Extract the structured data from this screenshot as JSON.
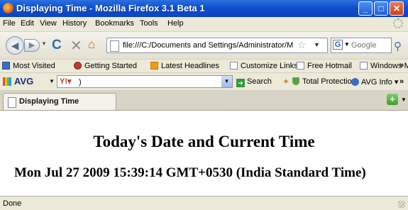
{
  "window": {
    "title": "Displaying Time - Mozilla Firefox 3.1 Beta 1",
    "buttons": {
      "minimize": "_",
      "maximize": "□",
      "close": "✕"
    }
  },
  "menu": {
    "items": [
      "File",
      "Edit",
      "View",
      "History",
      "Bookmarks",
      "Tools",
      "Help"
    ]
  },
  "navigation": {
    "url": "file:///C:/Documents and Settings/Administrator/M",
    "search_engine_initial": "G",
    "search_placeholder": "Google"
  },
  "bookmarks": {
    "items": [
      "Most Visited",
      "Getting Started",
      "Latest Headlines",
      "Customize Links",
      "Free Hotmail",
      "Windows Marketplace"
    ],
    "more": "»"
  },
  "avg_toolbar": {
    "logo": "AVG",
    "input_value": ")",
    "search_label": "Search",
    "total_protection_label": "Total Protection",
    "info_label": "AVG Info",
    "info_dropdown": "▾",
    "more": "»"
  },
  "tabs": [
    {
      "label": "Displaying Time",
      "active": true
    }
  ],
  "new_tab_label": "+",
  "content": {
    "heading": "Today's Date and Current Time",
    "time": "Mon Jul 27 2009 15:39:14 GMT+0530 (India Standard Time)"
  },
  "status": {
    "text": "Done"
  },
  "colors": {
    "titlebar": "#0f4fcf",
    "chrome": "#ece9d8",
    "page_background": "#ffffff"
  }
}
